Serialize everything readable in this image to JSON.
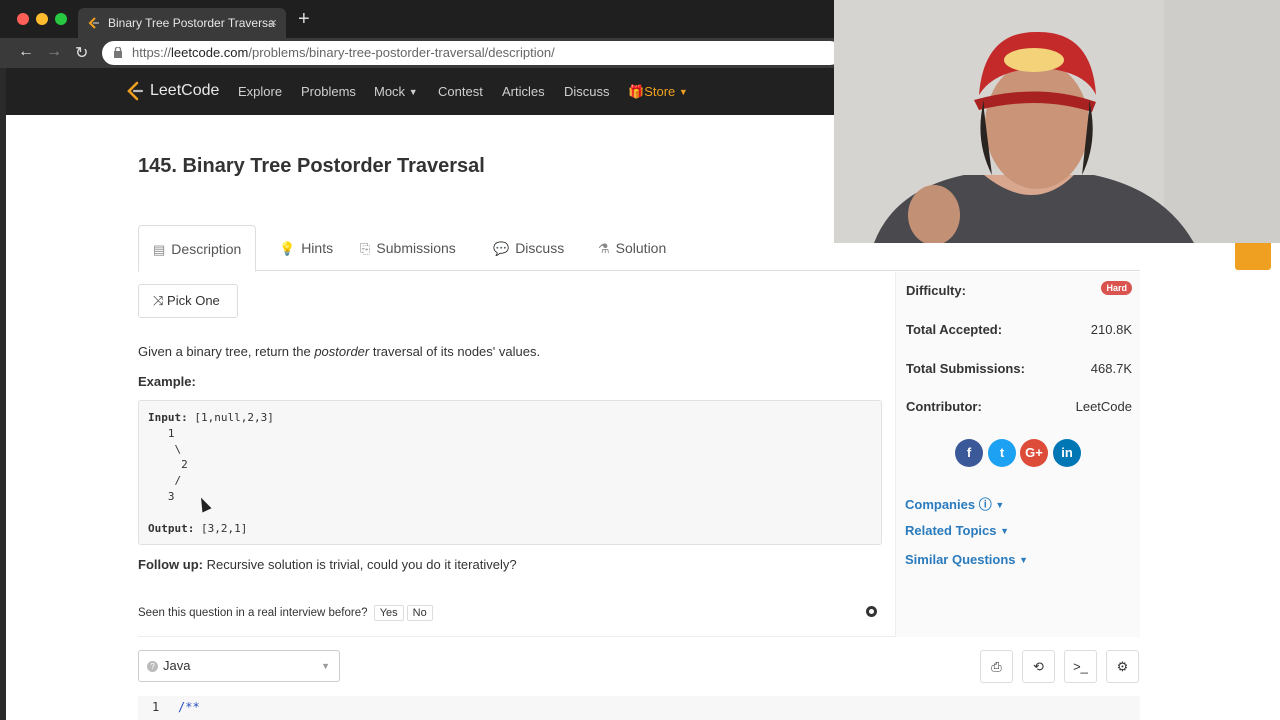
{
  "browser": {
    "tab_title": "Binary Tree Postorder Traversa",
    "close_glyph": "×",
    "new_tab_glyph": "+",
    "url_scheme": "https://",
    "url_host": "leetcode.com",
    "url_path": "/problems/binary-tree-postorder-traversal/description/"
  },
  "nav": {
    "logo": "LeetCode",
    "links": [
      "Explore",
      "Problems",
      "Mock",
      "Contest",
      "Articles",
      "Discuss"
    ],
    "store": "Store"
  },
  "problem": {
    "title": "145. Binary Tree Postorder Traversal",
    "tabs": [
      "Description",
      "Hints",
      "Submissions",
      "Discuss",
      "Solution"
    ],
    "pick_one": "Pick One",
    "desc_before": "Given a binary tree, return the ",
    "desc_em": "postorder",
    "desc_after": " traversal of its nodes' values.",
    "example_heading": "Example:",
    "input_label": "Input:",
    "input_value": " [1,null,2,3]",
    "tree_lines": "   1\n    \\\n     2\n    /\n   3",
    "output_label": "Output:",
    "output_value": " [3,2,1]",
    "follow_label": "Follow up:",
    "follow_text": " Recursive solution is trivial, could you do it iteratively?",
    "seen_question": "Seen this question in a real interview before?",
    "yes": "Yes",
    "no": "No"
  },
  "editor": {
    "language": "Java",
    "line_number": "1",
    "first_line": "/**"
  },
  "sidebar": {
    "difficulty_label": "Difficulty:",
    "difficulty_value": "Hard",
    "accepted_label": "Total Accepted:",
    "accepted_value": "210.8K",
    "submissions_label": "Total Submissions:",
    "submissions_value": "468.7K",
    "contributor_label": "Contributor:",
    "contributor_value": "LeetCode",
    "companies": "Companies",
    "related_topics": "Related Topics",
    "similar_questions": "Similar Questions"
  },
  "colors": {
    "facebook": "#3b5998",
    "twitter": "#1da1f2",
    "google": "#dd4b39",
    "linkedin": "#0077b5",
    "hard": "#d9534f",
    "link": "#2a7bbd"
  }
}
